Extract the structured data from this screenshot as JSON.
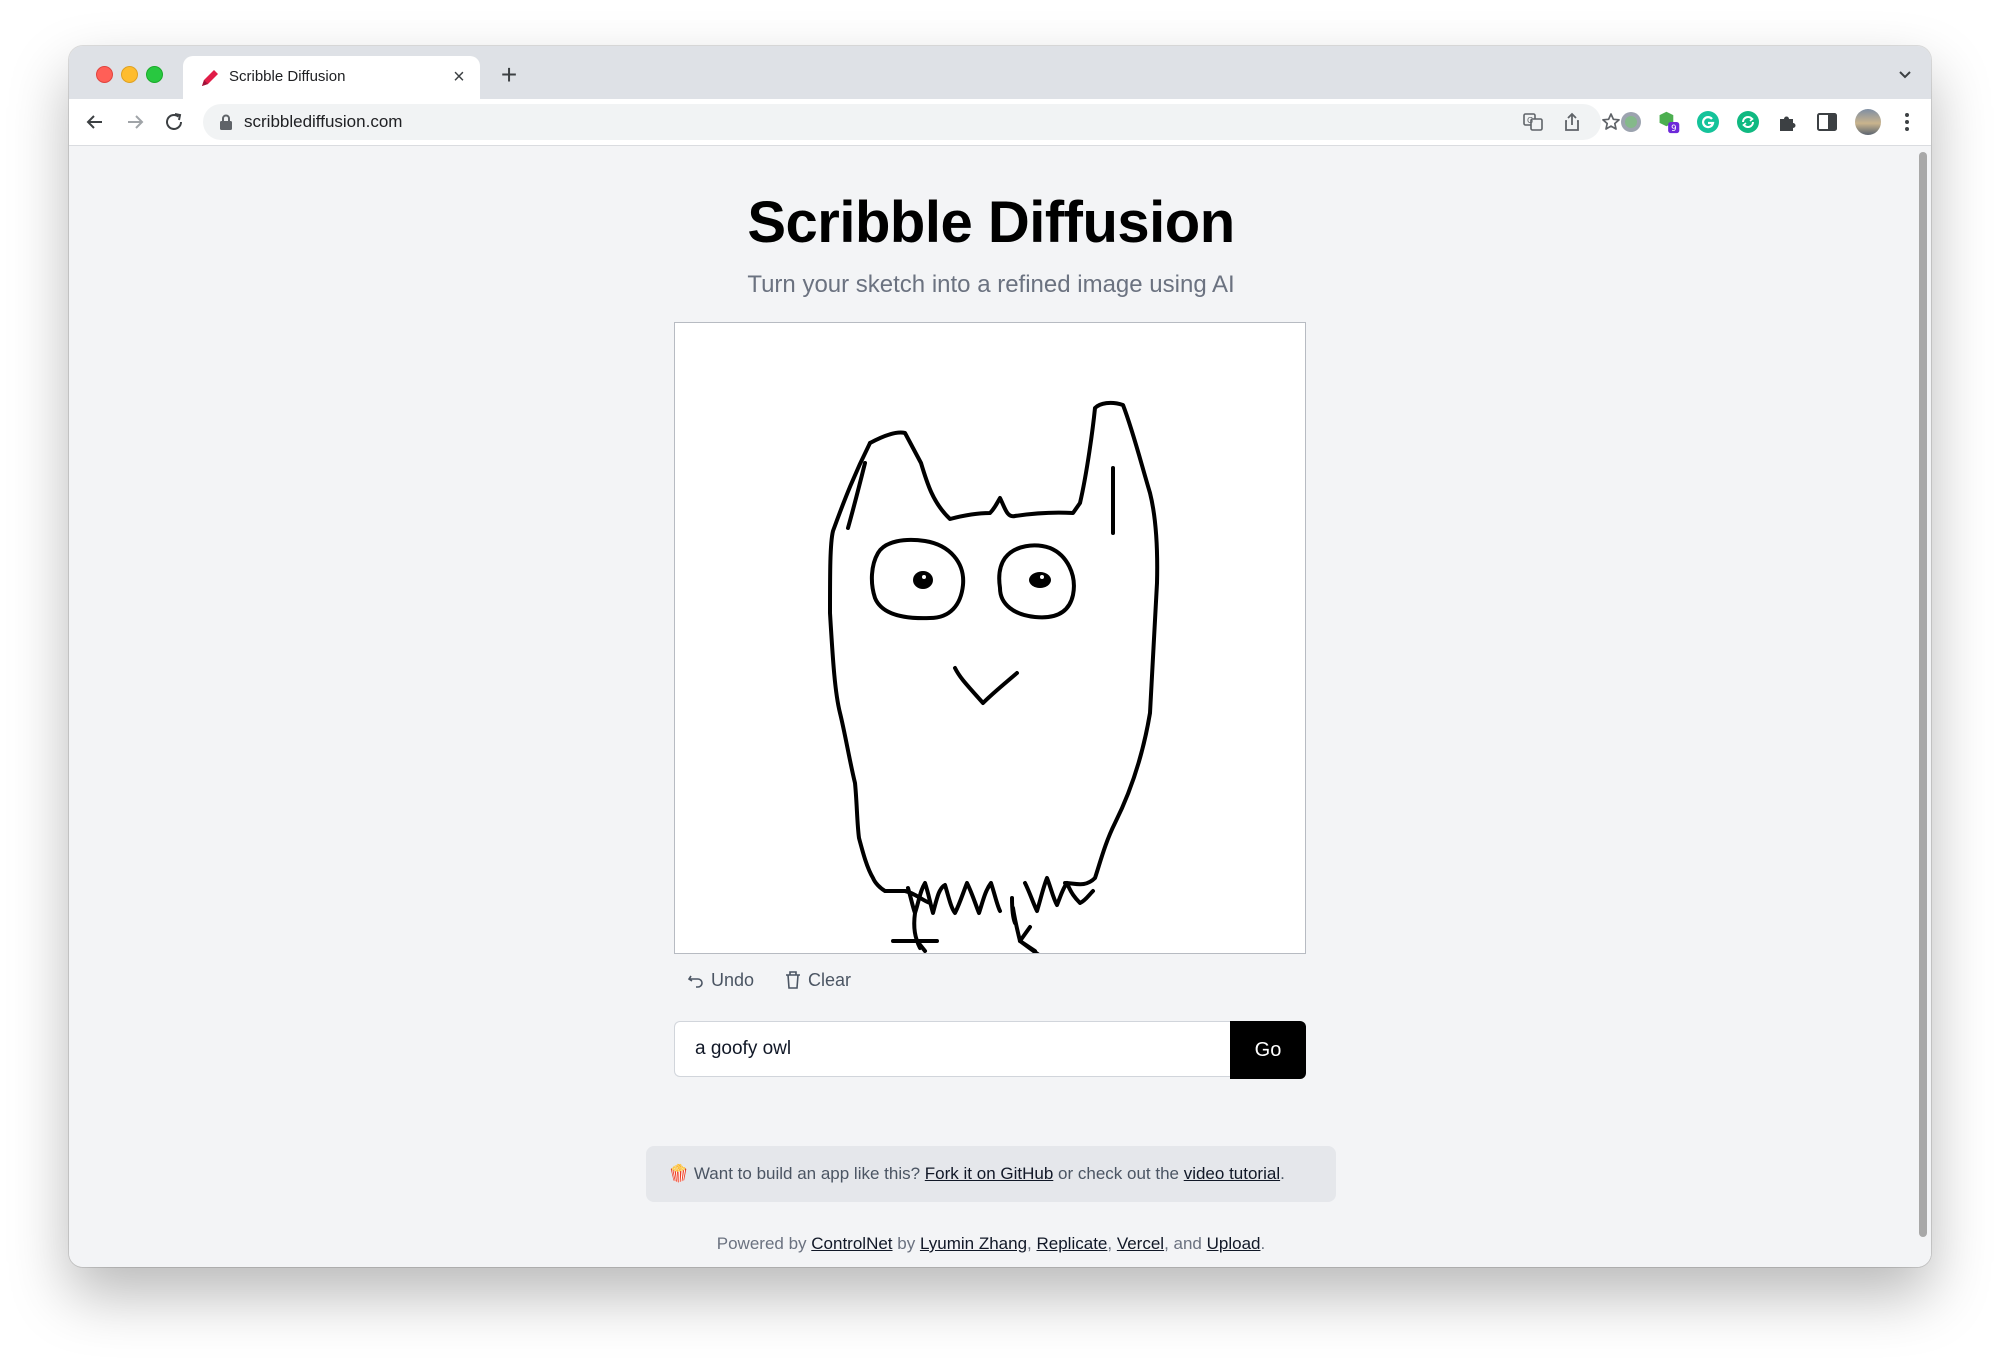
{
  "browser": {
    "tab_title": "Scribble Diffusion",
    "tab_close": "×",
    "new_tab": "+",
    "url": "scribblediffusion.com",
    "extension_badge": "9"
  },
  "page": {
    "title": "Scribble Diffusion",
    "subtitle": "Turn your sketch into a refined image using AI",
    "undo_label": "Undo",
    "clear_label": "Clear",
    "prompt_value": "a goofy owl",
    "go_label": "Go"
  },
  "promo": {
    "emoji": "🍿",
    "text_before": " Want to build an app like this? ",
    "github_link": "Fork it on GitHub",
    "text_middle": " or check out the ",
    "tutorial_link": "video tutorial",
    "text_after": "."
  },
  "footer": {
    "prefix": "Powered by ",
    "controlnet": "ControlNet",
    "by": " by ",
    "author": "Lyumin Zhang",
    "sep1": ", ",
    "replicate": "Replicate",
    "sep2": ", ",
    "vercel": "Vercel",
    "and": ", and ",
    "upload": "Upload",
    "end": "."
  },
  "colors": {
    "page_bg": "#f3f4f6",
    "button_bg": "#000000",
    "subtitle": "#6b7280"
  }
}
